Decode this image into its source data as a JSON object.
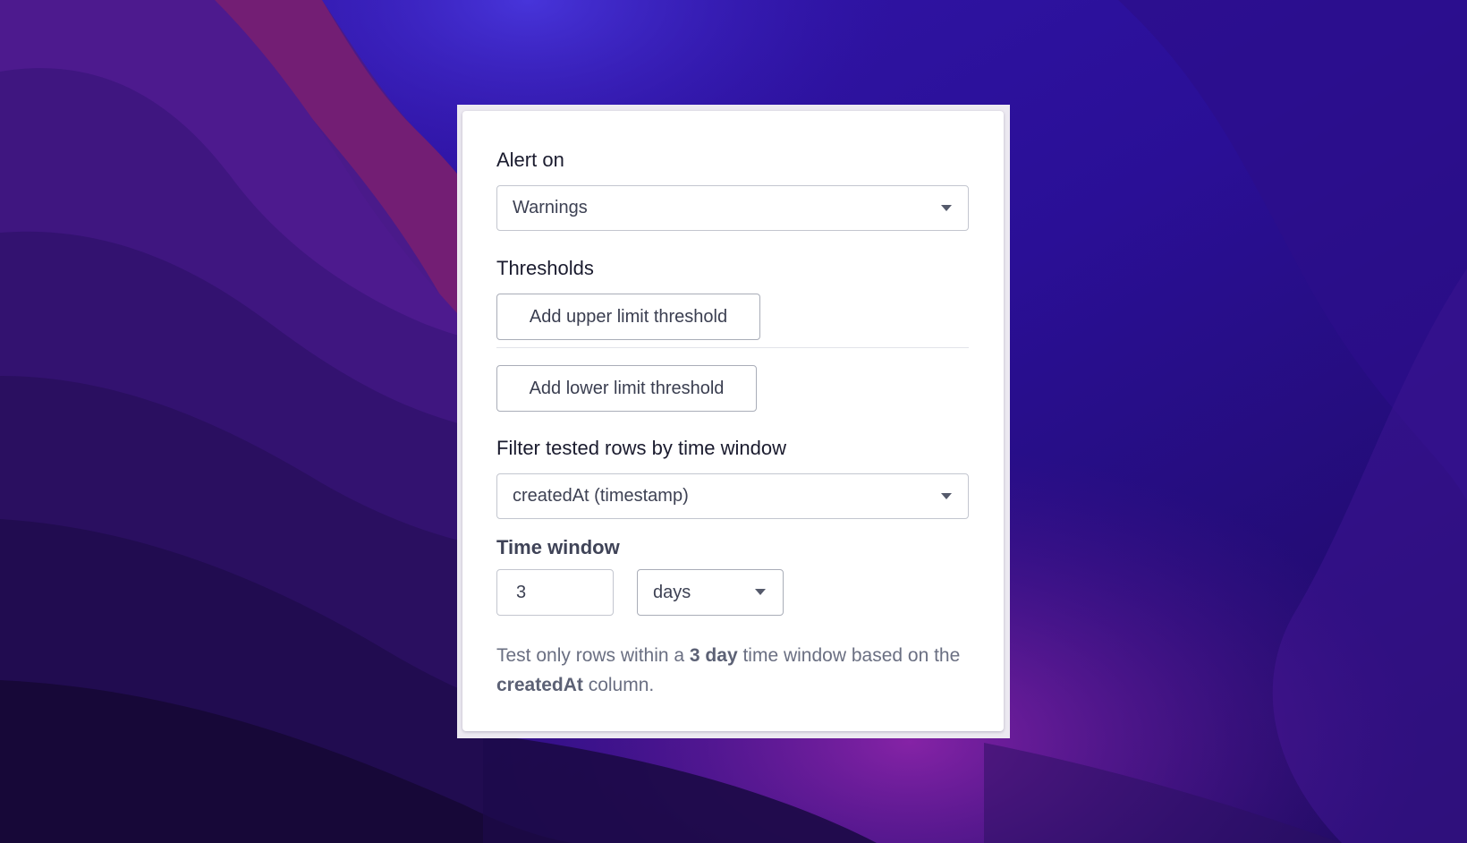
{
  "alert_on": {
    "label": "Alert on",
    "selected": "Warnings"
  },
  "thresholds": {
    "label": "Thresholds",
    "add_upper_label": "Add upper limit threshold",
    "add_lower_label": "Add lower limit threshold"
  },
  "filter": {
    "label": "Filter tested rows by time window",
    "selected": "createdAt (timestamp)"
  },
  "time_window": {
    "label": "Time window",
    "value": "3",
    "unit": "days"
  },
  "helper": {
    "prefix": "Test only rows within a ",
    "window": "3 day",
    "middle": " time window based on the ",
    "column": "createdAt",
    "suffix": " column."
  },
  "colors": {
    "card_bg": "#ffffff",
    "label_text": "#1a1b2e",
    "helper_text": "#6a6f82",
    "border": "#c3c6cf",
    "wallpaper_primary": "#2f12a8",
    "wallpaper_accent": "#7a1c9a"
  }
}
